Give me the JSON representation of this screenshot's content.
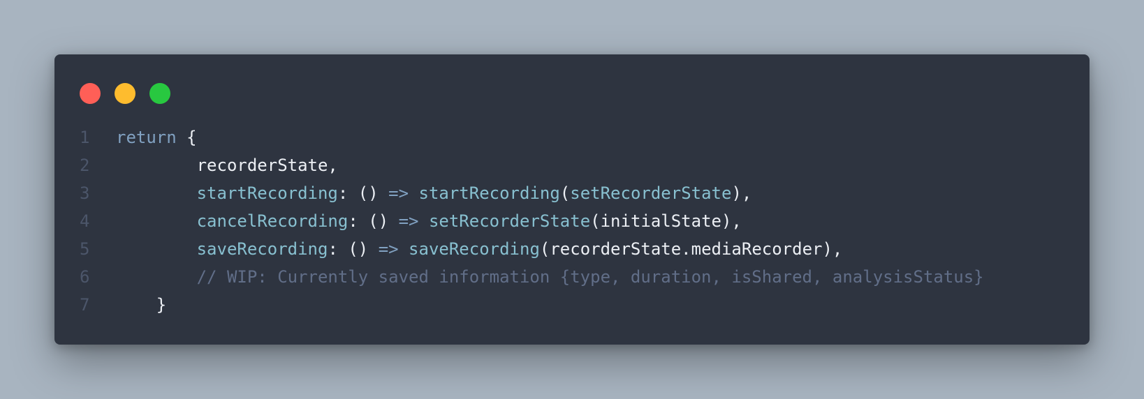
{
  "window": {
    "traffic_lights": {
      "close_color": "#ff5f57",
      "minimize_color": "#febc2e",
      "zoom_color": "#28c840"
    }
  },
  "code": {
    "lines": [
      {
        "number": "1",
        "tokens": [
          {
            "t": "return",
            "c": "kw"
          },
          {
            "t": " {",
            "c": "var"
          }
        ]
      },
      {
        "number": "2",
        "tokens": [
          {
            "t": "        recorderState,",
            "c": "var"
          }
        ]
      },
      {
        "number": "3",
        "tokens": [
          {
            "t": "        ",
            "c": "var"
          },
          {
            "t": "startRecording",
            "c": "fn"
          },
          {
            "t": ": () ",
            "c": "var"
          },
          {
            "t": "=>",
            "c": "op"
          },
          {
            "t": " ",
            "c": "var"
          },
          {
            "t": "startRecording",
            "c": "fn"
          },
          {
            "t": "(",
            "c": "var"
          },
          {
            "t": "setRecorderState",
            "c": "fn"
          },
          {
            "t": "),",
            "c": "var"
          }
        ]
      },
      {
        "number": "4",
        "tokens": [
          {
            "t": "        ",
            "c": "var"
          },
          {
            "t": "cancelRecording",
            "c": "fn"
          },
          {
            "t": ": () ",
            "c": "var"
          },
          {
            "t": "=>",
            "c": "op"
          },
          {
            "t": " ",
            "c": "var"
          },
          {
            "t": "setRecorderState",
            "c": "fn"
          },
          {
            "t": "(initialState),",
            "c": "var"
          }
        ]
      },
      {
        "number": "5",
        "tokens": [
          {
            "t": "        ",
            "c": "var"
          },
          {
            "t": "saveRecording",
            "c": "fn"
          },
          {
            "t": ": () ",
            "c": "var"
          },
          {
            "t": "=>",
            "c": "op"
          },
          {
            "t": " ",
            "c": "var"
          },
          {
            "t": "saveRecording",
            "c": "fn"
          },
          {
            "t": "(recorderState.mediaRecorder),",
            "c": "var"
          }
        ]
      },
      {
        "number": "6",
        "tokens": [
          {
            "t": "        ",
            "c": "var"
          },
          {
            "t": "// WIP: Currently saved information {type, duration, isShared, analysisStatus}",
            "c": "cm"
          }
        ]
      },
      {
        "number": "7",
        "tokens": [
          {
            "t": "    }",
            "c": "var"
          }
        ]
      }
    ]
  }
}
